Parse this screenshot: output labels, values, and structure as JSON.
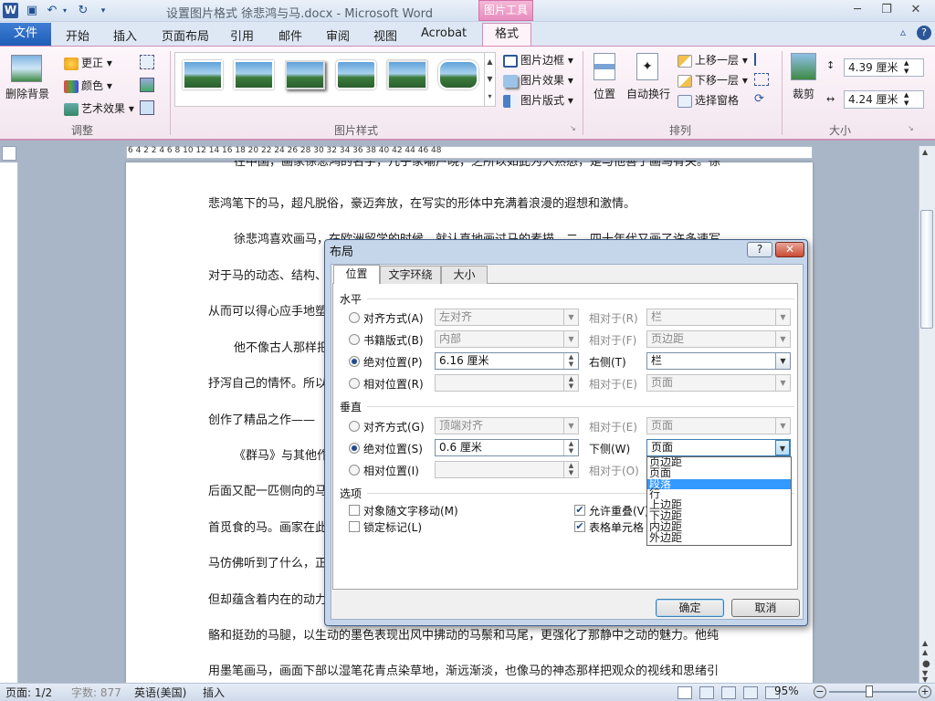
{
  "titlebar": {
    "doc_title": "设置图片格式 徐悲鸿与马.docx - Microsoft Word",
    "context_tab": "图片工具",
    "app_icon": "W"
  },
  "tabs": {
    "file": "文件",
    "items": [
      "开始",
      "插入",
      "页面布局",
      "引用",
      "邮件",
      "审阅",
      "视图",
      "Acrobat"
    ],
    "format": "格式"
  },
  "ribbon": {
    "adjust": {
      "remove_bg": "删除背景",
      "corrections": "更正 ▾",
      "color": "颜色 ▾",
      "artistic": "艺术效果 ▾",
      "label": "调整"
    },
    "styles": {
      "label": "图片样式",
      "border": "图片边框 ▾",
      "effects": "图片效果 ▾",
      "layout": "图片版式 ▾"
    },
    "arrange": {
      "position": "位置",
      "wrap": "自动换行",
      "forward": "上移一层 ▾",
      "backward": "下移一层 ▾",
      "selection": "选择窗格",
      "label": "排列"
    },
    "size": {
      "crop": "裁剪",
      "height": "4.39 厘米",
      "width": "4.24 厘米",
      "label": "大小"
    }
  },
  "ruler": {
    "numbers": "6    4    2         2    4    6    8   10   12   14   16   18   20   22   24   26   28   30   32   34   36   38   40   42   44   46   48"
  },
  "document": {
    "lines": [
      "在中国，画家徐悲鸿的名字，几乎家喻户晓，之所以如此为人熟悉，是与他善于画马有关。徐",
      "悲鸿笔下的马，超凡脱俗，豪迈奔放，在写实的形体中充满着浪漫的遐想和激情。",
      "徐悲鸿喜欢画马，在欧洲留学的时候，就认真地画过马的素描，二、四十年代又画了许多速写，",
      "对于马的动态、结构、",
      "从而可以得心应手地塑",
      "他不像古人那样把",
      "抒泻自己的情怀。所以",
      "创作了精品之作——",
      "《群马》与其他作",
      "后面又配一匹侧向的马",
      "首觅食的马。画家在此",
      "马仿佛听到了什么，正",
      "但却蕴含着内在的动力",
      "骼和挺劲的马腿，以生动的墨色表现出风中拂动的马鬃和马尾，更强化了那静中之动的魅力。他纯",
      "用墨笔画马，画面下部以湿笔花青点染草地，渐远渐淡，也像马的神态那样把观众的视线和思绪引"
    ]
  },
  "status": {
    "page": "页面: 1/2",
    "words": "字数: 877",
    "lang": "英语(美国)",
    "mode": "插入",
    "zoom": "95%"
  },
  "dialog": {
    "title": "布局",
    "help": "?",
    "close": "✕",
    "tabs": [
      "位置",
      "文字环绕",
      "大小"
    ],
    "horizontal": {
      "section": "水平",
      "align_label": "对齐方式(A)",
      "align_value": "左对齐",
      "align_rel_label": "相对于(R)",
      "align_rel_value": "栏",
      "book_label": "书籍版式(B)",
      "book_value": "内部",
      "book_rel_label": "相对于(F)",
      "book_rel_value": "页边距",
      "abs_label": "绝对位置(P)",
      "abs_value": "6.16 厘米",
      "abs_rel_label": "右侧(T)",
      "abs_rel_value": "栏",
      "relpos_label": "相对位置(R)",
      "relpos_rel_label": "相对于(E)",
      "relpos_rel_value": "页面"
    },
    "vertical": {
      "section": "垂直",
      "align_label": "对齐方式(G)",
      "align_value": "顶端对齐",
      "align_rel_label": "相对于(E)",
      "align_rel_value": "页面",
      "abs_label": "绝对位置(S)",
      "abs_value": "0.6 厘米",
      "abs_rel_label": "下侧(W)",
      "abs_rel_value": "页面",
      "relpos_label": "相对位置(I)",
      "relpos_rel_label": "相对于(O)"
    },
    "dropdown_options": [
      "页边距",
      "页面",
      "段落",
      "行",
      "上边距",
      "下边距",
      "内边距",
      "外边距"
    ],
    "options": {
      "section": "选项",
      "move_with_text": "对象随文字移动(M)",
      "lock_anchor": "锁定标记(L)",
      "allow_overlap": "允许重叠(V)",
      "layout_in_cell": "表格单元格"
    },
    "ok": "确定",
    "cancel": "取消"
  },
  "colors": {
    "accent": "#2b579a",
    "context": "#e88cbf",
    "selection": "#3399ff"
  }
}
